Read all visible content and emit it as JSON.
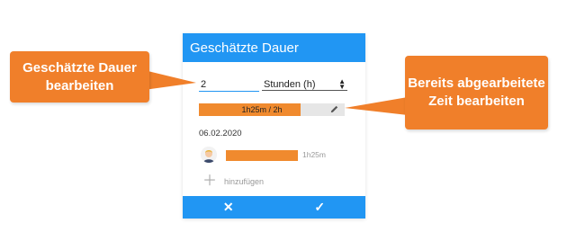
{
  "dialog": {
    "title": "Geschätzte Dauer",
    "estimate_value": "2",
    "unit_selected": "Stunden (h)",
    "progress_label": "1h25m / 2h",
    "progress_fraction": 0.7,
    "date": "06.02.2020",
    "entry_time": "1h25m",
    "add_label": "hinzufügen",
    "cancel_glyph": "✕",
    "confirm_glyph": "✓"
  },
  "callouts": {
    "left": "Geschätzte Dauer bearbeiten",
    "right": "Bereits abgearbeitete Zeit bearbeiten"
  },
  "colors": {
    "primary": "#2196f3",
    "accent": "#f08a2e",
    "callout": "#f07f2a"
  },
  "icons": {
    "pencil": "pencil-icon",
    "plus": "plus-icon",
    "close": "close-icon",
    "check": "check-icon"
  }
}
